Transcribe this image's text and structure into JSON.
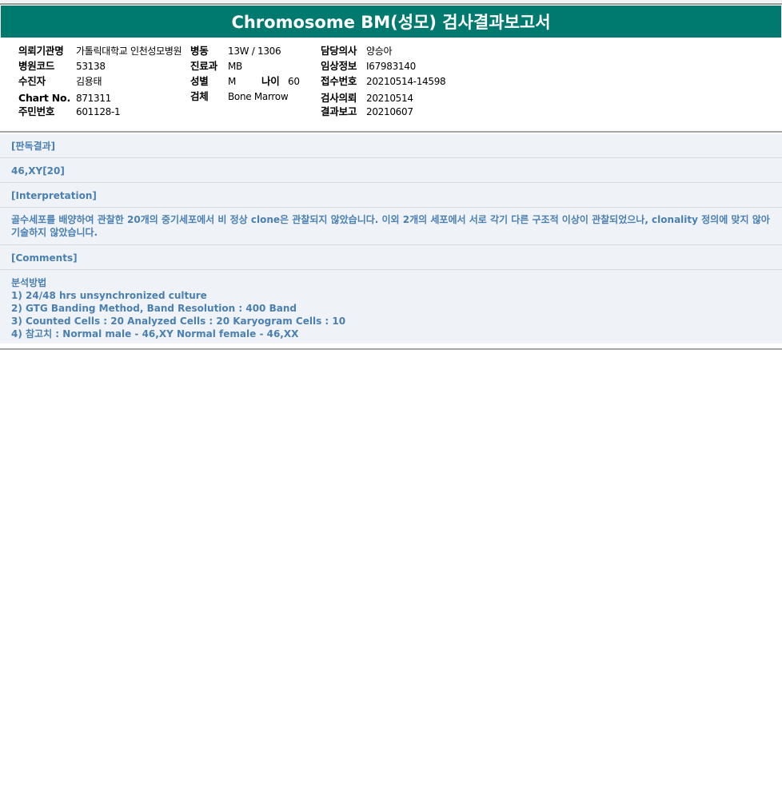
{
  "title": "Chromosome BM(성모) 검사결과보고서",
  "info": {
    "institution_label": "의뢰기관명",
    "institution_value": "가톨릭대학교 인천성모병원",
    "ward_label": "병동",
    "ward_value": "13W / 1306",
    "doctor_label": "담당의사",
    "doctor_value": "양승아",
    "hospital_code_label": "병원코드",
    "hospital_code_value": "53138",
    "dept_label": "진료과",
    "dept_value": "MB",
    "clinical_label": "임상정보",
    "clinical_value": "I67983140",
    "patient_label": "수진자",
    "patient_value": "김용태",
    "sex_label": "성별",
    "sex_value": "M",
    "age_label": "나이",
    "age_value": "60",
    "receipt_label": "접수번호",
    "receipt_value": "20210514-14598",
    "chart_label": "Chart No.",
    "chart_value": "871311",
    "specimen_label": "검체",
    "specimen_value": "Bone Marrow",
    "request_label": "검사의뢰",
    "request_value": "20210514",
    "id_label": "주민번호",
    "id_value": "601128-1",
    "report_label": "결과보고",
    "report_value": "20210607"
  },
  "sections": {
    "result_header": "[판독결과]",
    "result_value": "46,XY[20]",
    "interp_header": "[Interpretation]",
    "interp_text": "골수세포를 배양하여 관찰한 20개의 중기세포에서 비 정상 clone은 관찰되지 않았습니다. 이외 2개의 세포에서 서로 각기 다른 구조적 이상이 관찰되었으나, clonality 정의에 맞지 않아 기술하지 않았습니다.",
    "comments_header": "[Comments]",
    "method_title": "분석방법",
    "method_1": "1) 24/48 hrs unsynchronized culture",
    "method_2": "2) GTG Banding Method, Band Resolution : 400 Band",
    "method_3": "3) Counted Cells : 20 Analyzed Cells : 20 Karyogram Cells : 10",
    "method_4": "4) 참고치 : Normal male - 46,XY Normal female - 46,XX"
  }
}
